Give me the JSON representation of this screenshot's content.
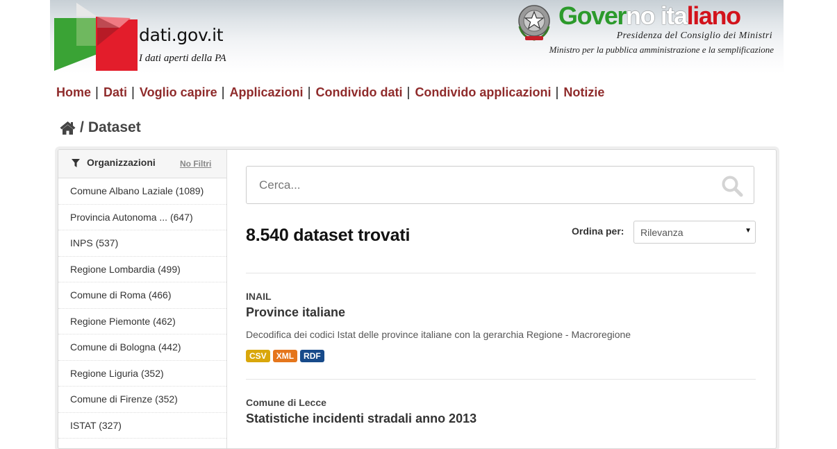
{
  "header": {
    "site_name": "dati.gov.it",
    "tagline": "I dati aperti della PA",
    "gov_title_parts": [
      "Gover",
      "no ita",
      "liano"
    ],
    "gov_subtitle_1": "Presidenza del Consiglio dei Ministri",
    "gov_subtitle_2": "Ministro per la pubblica amministrazione e la semplificazione"
  },
  "nav": {
    "items": [
      {
        "label": "Home"
      },
      {
        "label": "Dati"
      },
      {
        "label": "Voglio capire"
      },
      {
        "label": "Applicazioni"
      },
      {
        "label": "Condivido dati"
      },
      {
        "label": "Condivido applicazioni"
      },
      {
        "label": "Notizie"
      }
    ],
    "separator": "|"
  },
  "breadcrumb": {
    "separator": "/",
    "current": "Dataset",
    "home_icon": "home-icon"
  },
  "sidebar": {
    "title": "Organizzazioni",
    "no_filters": "No Filtri",
    "icon": "filter-icon",
    "items": [
      {
        "label": "Comune Albano Laziale (1089)"
      },
      {
        "label": "Provincia Autonoma ... (647)"
      },
      {
        "label": "INPS (537)"
      },
      {
        "label": "Regione Lombardia (499)"
      },
      {
        "label": "Comune di Roma (466)"
      },
      {
        "label": "Regione Piemonte (462)"
      },
      {
        "label": "Comune di Bologna (442)"
      },
      {
        "label": "Regione Liguria (352)"
      },
      {
        "label": "Comune di Firenze (352)"
      },
      {
        "label": "ISTAT (327)"
      }
    ]
  },
  "search": {
    "placeholder": "Cerca...",
    "icon": "search-icon"
  },
  "results": {
    "count_text": "8.540 dataset trovati",
    "sort_label": "Ordina per:",
    "sort_value": "Rilevanza",
    "datasets": [
      {
        "org": "INAIL",
        "title": "Province italiane",
        "notes": "Decodifica dei codici Istat delle province italiane con la gerarchia Regione - Macroregione",
        "formats": [
          "CSV",
          "XML",
          "RDF"
        ]
      },
      {
        "org": "Comune di Lecce",
        "title": "Statistiche incidenti stradali anno 2013",
        "notes": "",
        "formats": []
      }
    ]
  },
  "colors": {
    "nav_link": "#8f2b2b",
    "csv": "#d9a70b",
    "xml": "#e5761c",
    "rdf": "#174a8a",
    "gov_green": "#2c9a2c",
    "gov_red": "#d2131c"
  }
}
